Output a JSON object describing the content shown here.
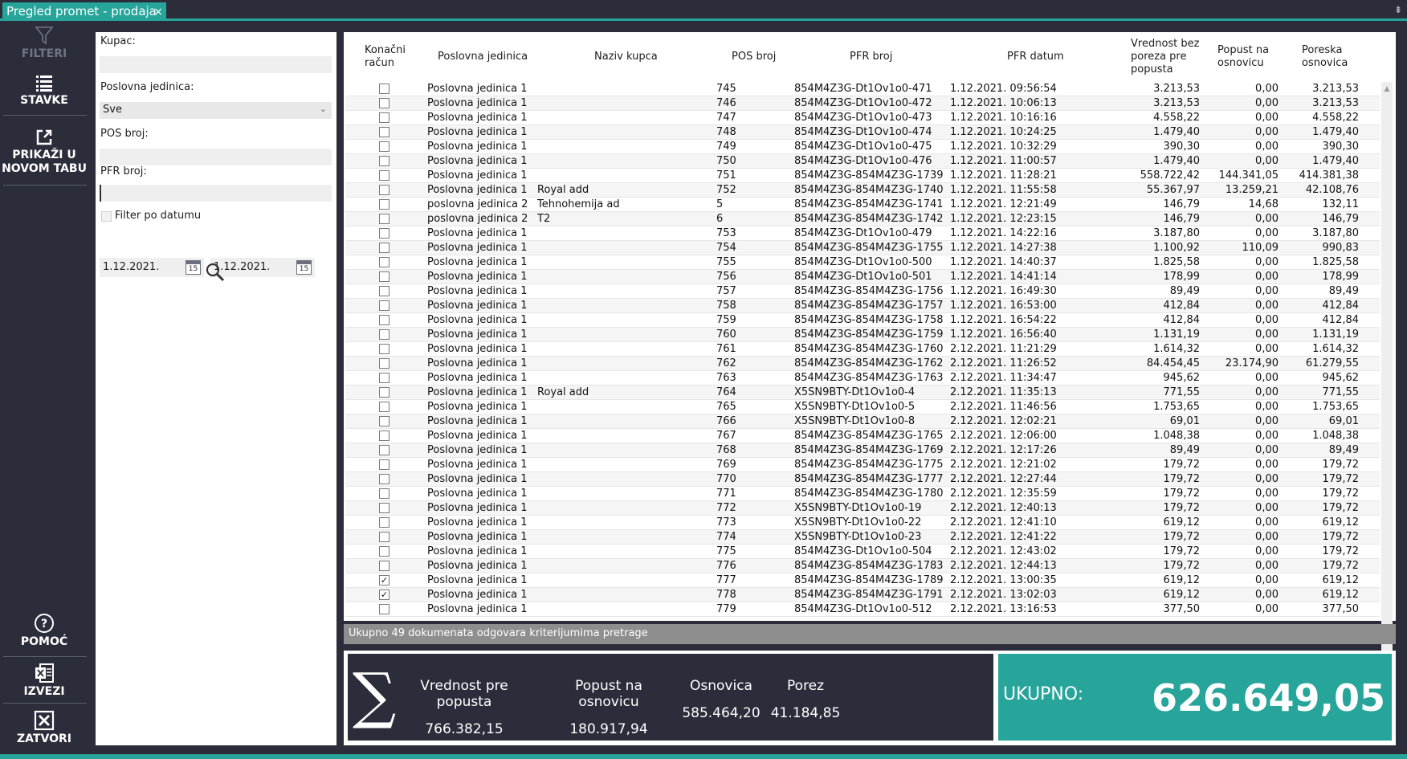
{
  "tab": {
    "title": "Pregled promet - prodaja",
    "close": "×",
    "pin": "⇟"
  },
  "nav": {
    "filteri": "FILTERI",
    "stavke": "STAVKE",
    "prikazi_1": "PRIKAŽI U",
    "prikazi_2": "NOVOM TABU",
    "pomoc": "POMOĆ",
    "izvezi": "IZVEZI",
    "zatvori": "ZATVORI"
  },
  "filters": {
    "kupac_label": "Kupac:",
    "kupac_value": "",
    "pj_label": "Poslovna jedinica:",
    "pj_value": "Sve",
    "pos_label": "POS broj:",
    "pos_value": "",
    "pfr_label": "PFR broj:",
    "pfr_value": "",
    "filter_datum_label": "Filter po datumu",
    "date_from": "1.12.2021.",
    "date_to": "1.12.2021.",
    "cal_day": "15"
  },
  "grid": {
    "headers": {
      "konacni_1": "Konačni",
      "konacni_2": "račun",
      "pj": "Poslovna jedinica",
      "kupac": "Naziv kupca",
      "pos": "POS broj",
      "pfr": "PFR broj",
      "datum": "PFR datum",
      "vr_1": "Vrednost bez",
      "vr_2": "poreza pre",
      "vr_3": "popusta",
      "pop_1": "Popust na",
      "pop_2": "osnovicu",
      "por_1": "Poreska",
      "por_2": "osnovica"
    },
    "rows": [
      {
        "chk": false,
        "pj": "Poslovna jedinica 1",
        "kupac": "",
        "pos": "745",
        "pfr": "854M4Z3G-Dt1Ov1o0-471",
        "datum": "1.12.2021. 09:56:54",
        "vr": "3.213,53",
        "pop": "0,00",
        "por": "3.213,53"
      },
      {
        "chk": false,
        "pj": "Poslovna jedinica 1",
        "kupac": "",
        "pos": "746",
        "pfr": "854M4Z3G-Dt1Ov1o0-472",
        "datum": "1.12.2021. 10:06:13",
        "vr": "3.213,53",
        "pop": "0,00",
        "por": "3.213,53"
      },
      {
        "chk": false,
        "pj": "Poslovna jedinica 1",
        "kupac": "",
        "pos": "747",
        "pfr": "854M4Z3G-Dt1Ov1o0-473",
        "datum": "1.12.2021. 10:16:16",
        "vr": "4.558,22",
        "pop": "0,00",
        "por": "4.558,22"
      },
      {
        "chk": false,
        "pj": "Poslovna jedinica 1",
        "kupac": "",
        "pos": "748",
        "pfr": "854M4Z3G-Dt1Ov1o0-474",
        "datum": "1.12.2021. 10:24:25",
        "vr": "1.479,40",
        "pop": "0,00",
        "por": "1.479,40"
      },
      {
        "chk": false,
        "pj": "Poslovna jedinica 1",
        "kupac": "",
        "pos": "749",
        "pfr": "854M4Z3G-Dt1Ov1o0-475",
        "datum": "1.12.2021. 10:32:29",
        "vr": "390,30",
        "pop": "0,00",
        "por": "390,30"
      },
      {
        "chk": false,
        "pj": "Poslovna jedinica 1",
        "kupac": "",
        "pos": "750",
        "pfr": "854M4Z3G-Dt1Ov1o0-476",
        "datum": "1.12.2021. 11:00:57",
        "vr": "1.479,40",
        "pop": "0,00",
        "por": "1.479,40"
      },
      {
        "chk": false,
        "pj": "Poslovna jedinica 1",
        "kupac": "",
        "pos": "751",
        "pfr": "854M4Z3G-854M4Z3G-1739",
        "datum": "1.12.2021. 11:28:21",
        "vr": "558.722,42",
        "pop": "144.341,05",
        "por": "414.381,38"
      },
      {
        "chk": false,
        "pj": "Poslovna jedinica 1",
        "kupac": "Royal add",
        "pos": "752",
        "pfr": "854M4Z3G-854M4Z3G-1740",
        "datum": "1.12.2021. 11:55:58",
        "vr": "55.367,97",
        "pop": "13.259,21",
        "por": "42.108,76"
      },
      {
        "chk": false,
        "pj": "poslovna jedinica 2",
        "kupac": "Tehnohemija ad",
        "pos": "5",
        "pfr": "854M4Z3G-854M4Z3G-1741",
        "datum": "1.12.2021. 12:21:49",
        "vr": "146,79",
        "pop": "14,68",
        "por": "132,11"
      },
      {
        "chk": false,
        "pj": "poslovna jedinica 2",
        "kupac": "T2",
        "pos": "6",
        "pfr": "854M4Z3G-854M4Z3G-1742",
        "datum": "1.12.2021. 12:23:15",
        "vr": "146,79",
        "pop": "0,00",
        "por": "146,79"
      },
      {
        "chk": false,
        "pj": "Poslovna jedinica 1",
        "kupac": "",
        "pos": "753",
        "pfr": "854M4Z3G-Dt1Ov1o0-479",
        "datum": "1.12.2021. 14:22:16",
        "vr": "3.187,80",
        "pop": "0,00",
        "por": "3.187,80"
      },
      {
        "chk": false,
        "pj": "Poslovna jedinica 1",
        "kupac": "",
        "pos": "754",
        "pfr": "854M4Z3G-854M4Z3G-1755",
        "datum": "1.12.2021. 14:27:38",
        "vr": "1.100,92",
        "pop": "110,09",
        "por": "990,83"
      },
      {
        "chk": false,
        "pj": "Poslovna jedinica 1",
        "kupac": "",
        "pos": "755",
        "pfr": "854M4Z3G-Dt1Ov1o0-500",
        "datum": "1.12.2021. 14:40:37",
        "vr": "1.825,58",
        "pop": "0,00",
        "por": "1.825,58"
      },
      {
        "chk": false,
        "pj": "Poslovna jedinica 1",
        "kupac": "",
        "pos": "756",
        "pfr": "854M4Z3G-Dt1Ov1o0-501",
        "datum": "1.12.2021. 14:41:14",
        "vr": "178,99",
        "pop": "0,00",
        "por": "178,99"
      },
      {
        "chk": false,
        "pj": "Poslovna jedinica 1",
        "kupac": "",
        "pos": "757",
        "pfr": "854M4Z3G-854M4Z3G-1756",
        "datum": "1.12.2021. 16:49:30",
        "vr": "89,49",
        "pop": "0,00",
        "por": "89,49"
      },
      {
        "chk": false,
        "pj": "Poslovna jedinica 1",
        "kupac": "",
        "pos": "758",
        "pfr": "854M4Z3G-854M4Z3G-1757",
        "datum": "1.12.2021. 16:53:00",
        "vr": "412,84",
        "pop": "0,00",
        "por": "412,84"
      },
      {
        "chk": false,
        "pj": "Poslovna jedinica 1",
        "kupac": "",
        "pos": "759",
        "pfr": "854M4Z3G-854M4Z3G-1758",
        "datum": "1.12.2021. 16:54:22",
        "vr": "412,84",
        "pop": "0,00",
        "por": "412,84"
      },
      {
        "chk": false,
        "pj": "Poslovna jedinica 1",
        "kupac": "",
        "pos": "760",
        "pfr": "854M4Z3G-854M4Z3G-1759",
        "datum": "1.12.2021. 16:56:40",
        "vr": "1.131,19",
        "pop": "0,00",
        "por": "1.131,19"
      },
      {
        "chk": false,
        "pj": "Poslovna jedinica 1",
        "kupac": "",
        "pos": "761",
        "pfr": "854M4Z3G-854M4Z3G-1760",
        "datum": "2.12.2021. 11:21:29",
        "vr": "1.614,32",
        "pop": "0,00",
        "por": "1.614,32"
      },
      {
        "chk": false,
        "pj": "Poslovna jedinica 1",
        "kupac": "",
        "pos": "762",
        "pfr": "854M4Z3G-854M4Z3G-1762",
        "datum": "2.12.2021. 11:26:52",
        "vr": "84.454,45",
        "pop": "23.174,90",
        "por": "61.279,55"
      },
      {
        "chk": false,
        "pj": "Poslovna jedinica 1",
        "kupac": "",
        "pos": "763",
        "pfr": "854M4Z3G-854M4Z3G-1763",
        "datum": "2.12.2021. 11:34:47",
        "vr": "945,62",
        "pop": "0,00",
        "por": "945,62"
      },
      {
        "chk": false,
        "pj": "Poslovna jedinica 1",
        "kupac": "Royal add",
        "pos": "764",
        "pfr": "X5SN9BTY-Dt1Ov1o0-4",
        "datum": "2.12.2021. 11:35:13",
        "vr": "771,55",
        "pop": "0,00",
        "por": "771,55"
      },
      {
        "chk": false,
        "pj": "Poslovna jedinica 1",
        "kupac": "",
        "pos": "765",
        "pfr": "X5SN9BTY-Dt1Ov1o0-5",
        "datum": "2.12.2021. 11:46:56",
        "vr": "1.753,65",
        "pop": "0,00",
        "por": "1.753,65"
      },
      {
        "chk": false,
        "pj": "Poslovna jedinica 1",
        "kupac": "",
        "pos": "766",
        "pfr": "X5SN9BTY-Dt1Ov1o0-8",
        "datum": "2.12.2021. 12:02:21",
        "vr": "69,01",
        "pop": "0,00",
        "por": "69,01"
      },
      {
        "chk": false,
        "pj": "Poslovna jedinica 1",
        "kupac": "",
        "pos": "767",
        "pfr": "854M4Z3G-854M4Z3G-1765",
        "datum": "2.12.2021. 12:06:00",
        "vr": "1.048,38",
        "pop": "0,00",
        "por": "1.048,38"
      },
      {
        "chk": false,
        "pj": "Poslovna jedinica 1",
        "kupac": "",
        "pos": "768",
        "pfr": "854M4Z3G-854M4Z3G-1769",
        "datum": "2.12.2021. 12:17:26",
        "vr": "89,49",
        "pop": "0,00",
        "por": "89,49"
      },
      {
        "chk": false,
        "pj": "Poslovna jedinica 1",
        "kupac": "",
        "pos": "769",
        "pfr": "854M4Z3G-854M4Z3G-1775",
        "datum": "2.12.2021. 12:21:02",
        "vr": "179,72",
        "pop": "0,00",
        "por": "179,72"
      },
      {
        "chk": false,
        "pj": "Poslovna jedinica 1",
        "kupac": "",
        "pos": "770",
        "pfr": "854M4Z3G-854M4Z3G-1777",
        "datum": "2.12.2021. 12:27:44",
        "vr": "179,72",
        "pop": "0,00",
        "por": "179,72"
      },
      {
        "chk": false,
        "pj": "Poslovna jedinica 1",
        "kupac": "",
        "pos": "771",
        "pfr": "854M4Z3G-854M4Z3G-1780",
        "datum": "2.12.2021. 12:35:59",
        "vr": "179,72",
        "pop": "0,00",
        "por": "179,72"
      },
      {
        "chk": false,
        "pj": "Poslovna jedinica 1",
        "kupac": "",
        "pos": "772",
        "pfr": "X5SN9BTY-Dt1Ov1o0-19",
        "datum": "2.12.2021. 12:40:13",
        "vr": "179,72",
        "pop": "0,00",
        "por": "179,72"
      },
      {
        "chk": false,
        "pj": "Poslovna jedinica 1",
        "kupac": "",
        "pos": "773",
        "pfr": "X5SN9BTY-Dt1Ov1o0-22",
        "datum": "2.12.2021. 12:41:10",
        "vr": "619,12",
        "pop": "0,00",
        "por": "619,12"
      },
      {
        "chk": false,
        "pj": "Poslovna jedinica 1",
        "kupac": "",
        "pos": "774",
        "pfr": "X5SN9BTY-Dt1Ov1o0-23",
        "datum": "2.12.2021. 12:41:22",
        "vr": "179,72",
        "pop": "0,00",
        "por": "179,72"
      },
      {
        "chk": false,
        "pj": "Poslovna jedinica 1",
        "kupac": "",
        "pos": "775",
        "pfr": "854M4Z3G-Dt1Ov1o0-504",
        "datum": "2.12.2021. 12:43:02",
        "vr": "179,72",
        "pop": "0,00",
        "por": "179,72"
      },
      {
        "chk": false,
        "pj": "Poslovna jedinica 1",
        "kupac": "",
        "pos": "776",
        "pfr": "854M4Z3G-854M4Z3G-1783",
        "datum": "2.12.2021. 12:44:13",
        "vr": "179,72",
        "pop": "0,00",
        "por": "179,72"
      },
      {
        "chk": true,
        "pj": "Poslovna jedinica 1",
        "kupac": "",
        "pos": "777",
        "pfr": "854M4Z3G-854M4Z3G-1789",
        "datum": "2.12.2021. 13:00:35",
        "vr": "619,12",
        "pop": "0,00",
        "por": "619,12"
      },
      {
        "chk": true,
        "pj": "Poslovna jedinica 1",
        "kupac": "",
        "pos": "778",
        "pfr": "854M4Z3G-854M4Z3G-1791",
        "datum": "2.12.2021. 13:02:03",
        "vr": "619,12",
        "pop": "0,00",
        "por": "619,12"
      },
      {
        "chk": false,
        "pj": "Poslovna jedinica 1",
        "kupac": "",
        "pos": "779",
        "pfr": "854M4Z3G-Dt1Ov1o0-512",
        "datum": "2.12.2021. 13:16:53",
        "vr": "377,50",
        "pop": "0,00",
        "por": "377,50"
      }
    ]
  },
  "status": "Ukupno 49 dokumenata odgovara kriterijumima pretrage",
  "summary": {
    "sigma": "∑",
    "vr_label": "Vrednost pre popusta",
    "vr_value": "766.382,15",
    "pop_label": "Popust na osnovicu",
    "pop_value": "180.917,94",
    "osn_label": "Osnovica",
    "osn_value": "585.464,20",
    "por_label": "Porez",
    "por_value": "41.184,85",
    "ukupno_label": "UKUPNO:",
    "ukupno_value": "626.649,05"
  },
  "colors": {
    "accent": "#27a59b",
    "dark": "#2b2e3a"
  }
}
